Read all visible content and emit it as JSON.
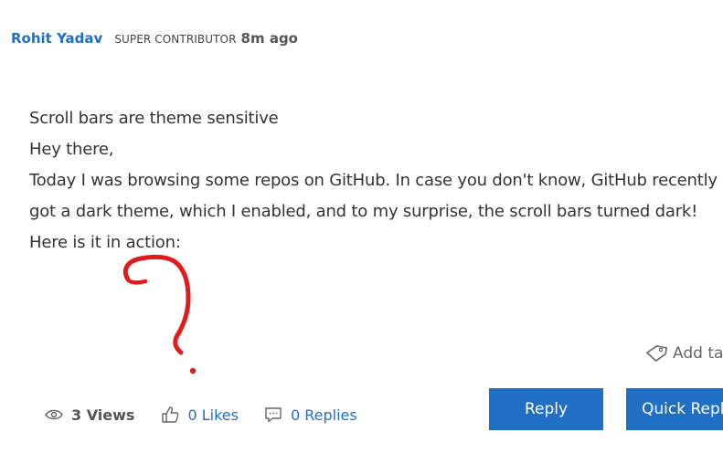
{
  "post": {
    "author": "Rohit Yadav",
    "rank": "SUPER CONTRIBUTOR",
    "time": "8m ago",
    "lines": [
      "Scroll bars are theme sensitive",
      "Hey there,",
      "Today I was browsing some repos on GitHub. In case you don't know, GitHub recently",
      "got a dark theme, which I enabled, and to my surprise, the scroll bars turned dark!",
      "Here is it in action:"
    ]
  },
  "tags": {
    "add_label": "Add tag"
  },
  "stats": {
    "views": "3 Views",
    "likes": "0 Likes",
    "replies": "0 Replies"
  },
  "actions": {
    "reply": "Reply",
    "quick_reply": "Quick Reply"
  },
  "colors": {
    "link": "#1f6fc5",
    "button": "#1f6fc5",
    "annotation": "#e01b1b"
  },
  "icons": {
    "views": "eye-icon",
    "likes": "thumbs-up-icon",
    "replies": "comment-icon",
    "tag": "tag-icon"
  }
}
